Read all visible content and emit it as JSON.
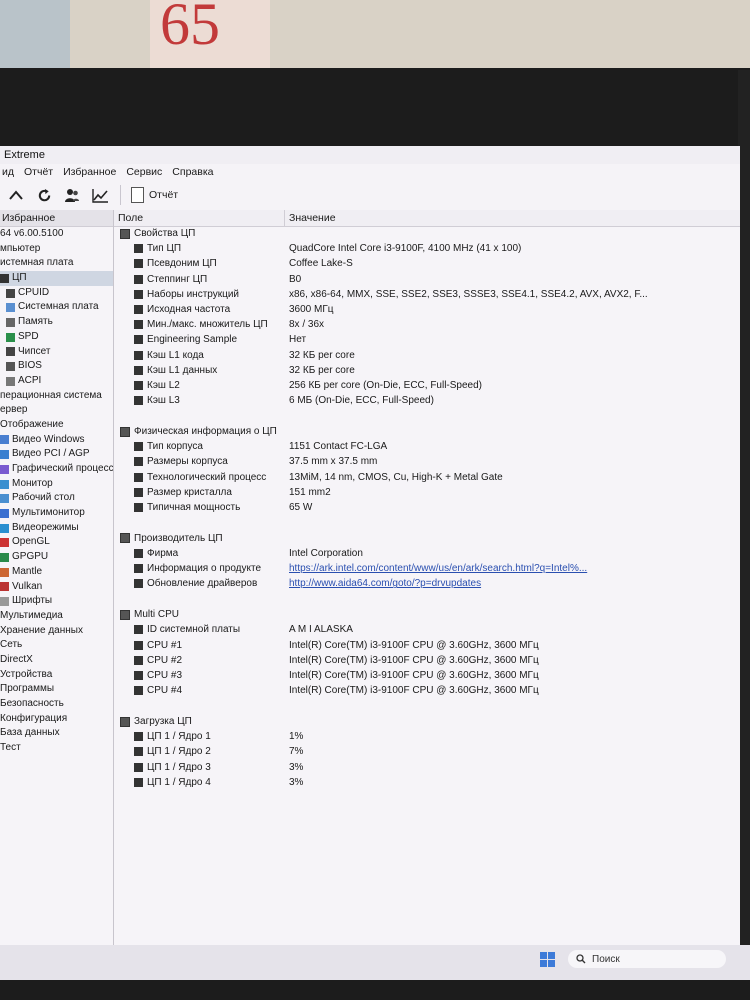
{
  "window": {
    "title": "Extreme"
  },
  "menu": [
    "ид",
    "Отчёт",
    "Избранное",
    "Сервис",
    "Справка"
  ],
  "toolbar": {
    "report_label": "Отчёт"
  },
  "sidebar": {
    "header": "Избранное",
    "items": [
      {
        "label": "64 v6.00.5100"
      },
      {
        "label": "мпьютер"
      },
      {
        "label": "истемная плата"
      },
      {
        "label": "ЦП",
        "selected": true
      },
      {
        "label": "CPUID"
      },
      {
        "label": "Системная плата"
      },
      {
        "label": "Память"
      },
      {
        "label": "SPD"
      },
      {
        "label": "Чипсет"
      },
      {
        "label": "BIOS"
      },
      {
        "label": "ACPI"
      },
      {
        "label": "перационная система"
      },
      {
        "label": "ервер"
      },
      {
        "label": "Отображение"
      },
      {
        "label": "Видео Windows"
      },
      {
        "label": "Видео PCI / AGP"
      },
      {
        "label": "Графический процесс"
      },
      {
        "label": "Монитор"
      },
      {
        "label": "Рабочий стол"
      },
      {
        "label": "Мультимонитор"
      },
      {
        "label": "Видеорежимы"
      },
      {
        "label": "OpenGL"
      },
      {
        "label": "GPGPU"
      },
      {
        "label": "Mantle"
      },
      {
        "label": "Vulkan"
      },
      {
        "label": "Шрифты"
      },
      {
        "label": "Мультимедиа"
      },
      {
        "label": "Хранение данных"
      },
      {
        "label": "Сеть"
      },
      {
        "label": "DirectX"
      },
      {
        "label": "Устройства"
      },
      {
        "label": "Программы"
      },
      {
        "label": "Безопасность"
      },
      {
        "label": "Конфигурация"
      },
      {
        "label": "База данных"
      },
      {
        "label": "Тест"
      }
    ]
  },
  "columns": {
    "field": "Поле",
    "value": "Значение"
  },
  "rows": [
    {
      "kind": "sec",
      "field": "Свойства ЦП",
      "value": ""
    },
    {
      "kind": "sub",
      "field": "Тип ЦП",
      "value": "QuadCore Intel Core i3-9100F, 4100 MHz (41 x 100)"
    },
    {
      "kind": "sub",
      "field": "Псевдоним ЦП",
      "value": "Coffee Lake-S"
    },
    {
      "kind": "sub",
      "field": "Степпинг ЦП",
      "value": "B0"
    },
    {
      "kind": "sub",
      "field": "Наборы инструкций",
      "value": "x86, x86-64, MMX, SSE, SSE2, SSE3, SSSE3, SSE4.1, SSE4.2, AVX, AVX2, F..."
    },
    {
      "kind": "sub",
      "field": "Исходная частота",
      "value": "3600 МГц"
    },
    {
      "kind": "sub",
      "field": "Мин./макс. множитель ЦП",
      "value": "8x / 36x"
    },
    {
      "kind": "sub",
      "field": "Engineering Sample",
      "value": "Нет"
    },
    {
      "kind": "sub",
      "field": "Кэш L1 кода",
      "value": "32 КБ per core"
    },
    {
      "kind": "sub",
      "field": "Кэш L1 данных",
      "value": "32 КБ per core"
    },
    {
      "kind": "sub",
      "field": "Кэш L2",
      "value": "256 КБ per core  (On-Die, ECC, Full-Speed)"
    },
    {
      "kind": "sub",
      "field": "Кэш L3",
      "value": "6 МБ  (On-Die, ECC, Full-Speed)"
    },
    {
      "kind": "gap"
    },
    {
      "kind": "sec",
      "field": "Физическая информация о ЦП",
      "value": ""
    },
    {
      "kind": "sub",
      "field": "Тип корпуса",
      "value": "1151 Contact FC-LGA"
    },
    {
      "kind": "sub",
      "field": "Размеры корпуса",
      "value": "37.5 mm x 37.5 mm"
    },
    {
      "kind": "sub",
      "field": "Технологический процесс",
      "value": "13MiM, 14 nm, CMOS, Cu, High-K + Metal Gate"
    },
    {
      "kind": "sub",
      "field": "Размер кристалла",
      "value": "151 mm2"
    },
    {
      "kind": "sub",
      "field": "Типичная мощность",
      "value": "65 W"
    },
    {
      "kind": "gap"
    },
    {
      "kind": "sec",
      "field": "Производитель ЦП",
      "value": ""
    },
    {
      "kind": "sub",
      "field": "Фирма",
      "value": "Intel Corporation"
    },
    {
      "kind": "sub",
      "field": "Информация о продукте",
      "value": "https://ark.intel.com/content/www/us/en/ark/search.html?q=Intel%...",
      "link": true
    },
    {
      "kind": "sub",
      "field": "Обновление драйверов",
      "value": "http://www.aida64.com/goto/?p=drvupdates",
      "link": true
    },
    {
      "kind": "gap"
    },
    {
      "kind": "sec",
      "field": "Multi CPU",
      "value": ""
    },
    {
      "kind": "sub",
      "field": "ID системной платы",
      "value": "A M I ALASKA"
    },
    {
      "kind": "sub",
      "field": "CPU #1",
      "value": "Intel(R) Core(TM) i3-9100F CPU @ 3.60GHz, 3600 МГц"
    },
    {
      "kind": "sub",
      "field": "CPU #2",
      "value": "Intel(R) Core(TM) i3-9100F CPU @ 3.60GHz, 3600 МГц"
    },
    {
      "kind": "sub",
      "field": "CPU #3",
      "value": "Intel(R) Core(TM) i3-9100F CPU @ 3.60GHz, 3600 МГц"
    },
    {
      "kind": "sub",
      "field": "CPU #4",
      "value": "Intel(R) Core(TM) i3-9100F CPU @ 3.60GHz, 3600 МГц"
    },
    {
      "kind": "gap"
    },
    {
      "kind": "sec",
      "field": "Загрузка ЦП",
      "value": ""
    },
    {
      "kind": "sub",
      "field": "ЦП 1 / Ядро 1",
      "value": "1%"
    },
    {
      "kind": "sub",
      "field": "ЦП 1 / Ядро 2",
      "value": "7%"
    },
    {
      "kind": "sub",
      "field": "ЦП 1 / Ядро 3",
      "value": "3%"
    },
    {
      "kind": "sub",
      "field": "ЦП 1 / Ядро 4",
      "value": "3%"
    }
  ],
  "taskbar": {
    "search_label": "Поиск"
  },
  "background": {
    "book_text": "65"
  }
}
